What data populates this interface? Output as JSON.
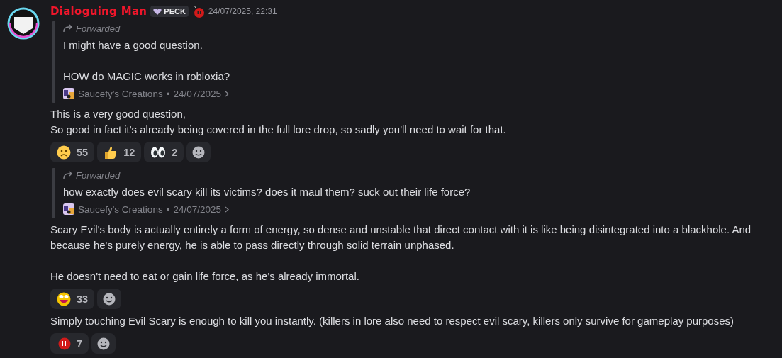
{
  "message": {
    "author": "Dialoguing Man",
    "tag": "PECK",
    "timestamp": "24/07/2025, 22:31",
    "blocks": [
      {
        "kind": "forward",
        "label": "Forwarded",
        "paragraphs": [
          [
            "I might have a good question."
          ],
          [
            "HOW do MAGIC works in robloxia?"
          ]
        ],
        "source": "Saucefy's Creations",
        "date": "24/07/2025",
        "separator": "•"
      },
      {
        "kind": "text",
        "paragraphs": [
          [
            "This is a very good question,",
            "So good in fact it's already being covered in the full lore drop, so sadly you'll need to wait for that."
          ]
        ]
      },
      {
        "kind": "reactions",
        "items": [
          {
            "kind": "frown",
            "count": "55"
          },
          {
            "kind": "thumbs",
            "count": "12"
          },
          {
            "kind": "eyes",
            "count": "2"
          }
        ]
      },
      {
        "kind": "forward",
        "label": "Forwarded",
        "paragraphs": [
          [
            "how exactly does evil scary kill its victims? does it maul them? suck  out their life force?"
          ]
        ],
        "source": "Saucefy's Creations",
        "date": "24/07/2025",
        "separator": "•"
      },
      {
        "kind": "text",
        "paragraphs": [
          [
            "Scary Evil's body is actually entirely a form of energy, so dense and unstable that direct contact with it is like being disintegrated into a blackhole. And",
            "because he's purely energy, he is able to pass directly through solid terrain unphased."
          ],
          [
            "He doesn't need to eat or gain life force, as he's already immortal."
          ]
        ]
      },
      {
        "kind": "reactions",
        "items": [
          {
            "kind": "grin",
            "count": "33"
          }
        ]
      },
      {
        "kind": "text",
        "paragraphs": [
          [
            "Simply touching Evil Scary is enough to kill you instantly. (killers in lore also need to respect evil scary, killers only survive for gameplay purposes)"
          ]
        ]
      },
      {
        "kind": "reactions",
        "items": [
          {
            "kind": "redface",
            "count": "7"
          }
        ]
      }
    ]
  }
}
